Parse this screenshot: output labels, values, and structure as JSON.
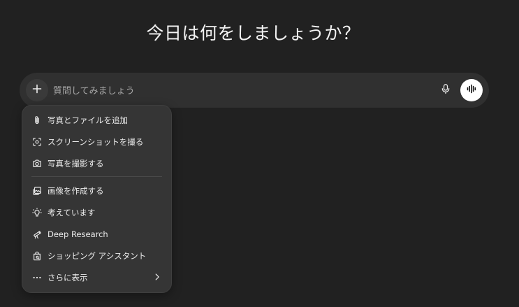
{
  "heading": "今日は何をしましょうか？",
  "composer": {
    "placeholder": "質問してみましょう",
    "icons": [
      "plus-icon",
      "microphone-icon",
      "voice-waveform-icon"
    ]
  },
  "menu": {
    "items": [
      {
        "label": "写真とファイルを追加",
        "icon": "paperclip-icon"
      },
      {
        "label": "スクリーンショットを撮る",
        "icon": "screenshot-icon"
      },
      {
        "label": "写真を撮影する",
        "icon": "camera-icon"
      },
      {
        "label": "画像を作成する",
        "icon": "image-create-icon"
      },
      {
        "label": "考えています",
        "icon": "lightbulb-icon"
      },
      {
        "label": "Deep Research",
        "icon": "telescope-icon"
      },
      {
        "label": "ショッピング アシスタント",
        "icon": "shopping-bag-icon"
      },
      {
        "label": "さらに表示",
        "icon": "more-dots-icon"
      }
    ]
  },
  "colors": {
    "background": "#212121",
    "composer": "#303030",
    "menu": "#353535",
    "text": "#ececec",
    "placeholder": "#a8a8a8"
  }
}
